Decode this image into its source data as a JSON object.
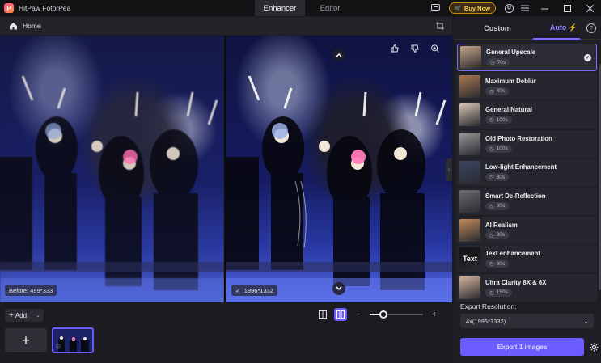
{
  "app": {
    "title": "HitPaw FotorPea",
    "logo_letter": "P"
  },
  "mode_tabs": [
    {
      "label": "Enhancer",
      "active": true
    },
    {
      "label": "Editor",
      "active": false
    }
  ],
  "titlebar": {
    "buy_label": "Buy Now"
  },
  "subbar": {
    "home_label": "Home"
  },
  "compare": {
    "before_label": "Before: 499*333",
    "after_label": "1996*1332"
  },
  "bottombar": {
    "add_label": "Add",
    "zoom_level": 0.25
  },
  "panel": {
    "tabs": [
      {
        "label": "Custom"
      },
      {
        "label": "Auto"
      }
    ],
    "modes": [
      {
        "name": "General Upscale",
        "time": "70s",
        "selected": true,
        "thumb_color": "#c9a58a"
      },
      {
        "name": "Maximum Deblur",
        "time": "40s",
        "selected": false,
        "thumb_color": "#a9784f"
      },
      {
        "name": "General Natural",
        "time": "100s",
        "selected": false,
        "thumb_color": "#d8c4b2"
      },
      {
        "name": "Old Photo Restoration",
        "time": "100s",
        "selected": false,
        "thumb_color": "#9a9a9a"
      },
      {
        "name": "Low-light Enhancement",
        "time": "80s",
        "selected": false,
        "thumb_color": "#3b4660"
      },
      {
        "name": "Smart De-Reflection",
        "time": "80s",
        "selected": false,
        "thumb_color": "#6a6a72"
      },
      {
        "name": "AI Realism",
        "time": "80s",
        "selected": false,
        "thumb_color": "#c08a5c"
      },
      {
        "name": "Text enhancement",
        "time": "80s",
        "selected": false,
        "thumb_color": "#111111"
      },
      {
        "name": "Ultra Clarity 8X & 6X",
        "time": "150s",
        "selected": false,
        "thumb_color": "#d2b49c"
      }
    ],
    "text_thumb_label": "Text",
    "export_label": "Export Resolution:",
    "export_value": "4x(1996*1332)",
    "export_button": "Export 1 images"
  }
}
